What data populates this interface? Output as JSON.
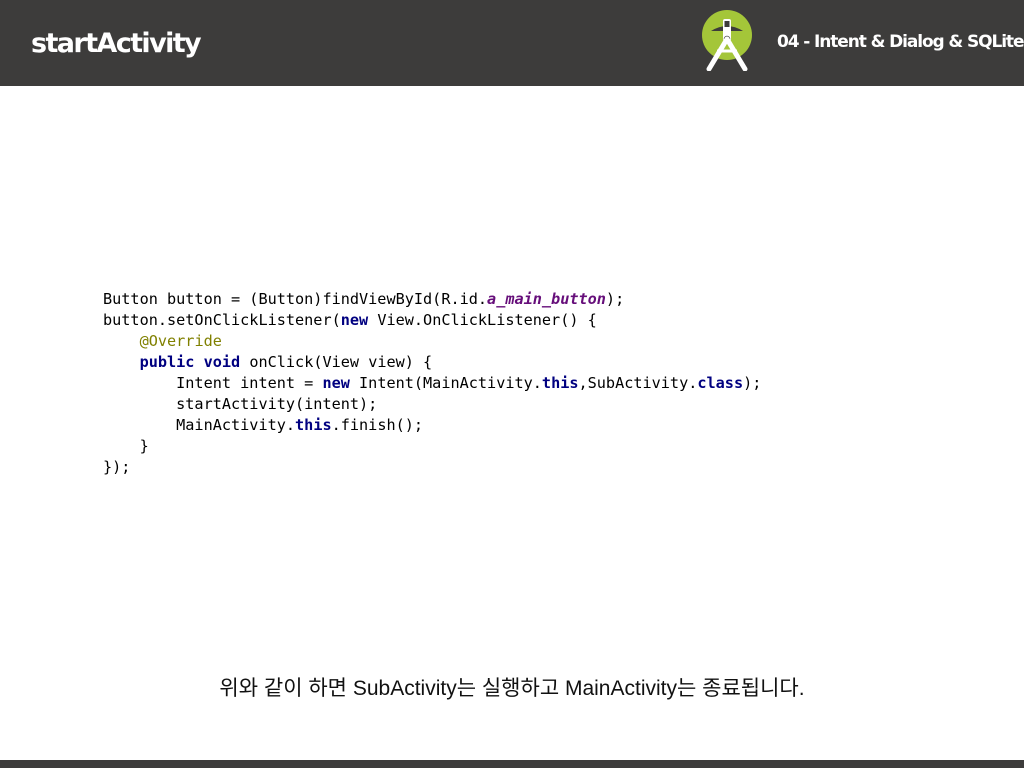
{
  "header": {
    "title": "startActivity",
    "chapter": "04 - Intent & Dialog & SQLite",
    "logo_icon": "android-studio-icon",
    "background_color": "#3d3c3b"
  },
  "code": {
    "line1": {
      "a": "Button button = (Button)findViewById(R.id.",
      "field": "a_main_button",
      "b": ");"
    },
    "line2": {
      "a": "button.setOnClickListener(",
      "kw": "new",
      "b": " View.OnClickListener() {"
    },
    "line3": {
      "indent": "    ",
      "annotation": "@Override"
    },
    "line4": {
      "indent": "    ",
      "kw1": "public",
      "sp": " ",
      "kw2": "void",
      "b": " onClick(View view) {"
    },
    "line5": {
      "a": "        Intent intent = ",
      "kw1": "new",
      "b": " Intent(MainActivity.",
      "kw2": "this",
      "c": ",SubActivity.",
      "kw3": "class",
      "d": ");"
    },
    "line6": {
      "a": "        startActivity(intent);"
    },
    "line7": {
      "a": "        MainActivity.",
      "kw": "this",
      "b": ".finish();"
    },
    "line8": {
      "a": "    }"
    },
    "line9": {
      "a": "});"
    }
  },
  "caption": "위와 같이 하면 SubActivity는 실행하고 MainActivity는 종료됩니다."
}
